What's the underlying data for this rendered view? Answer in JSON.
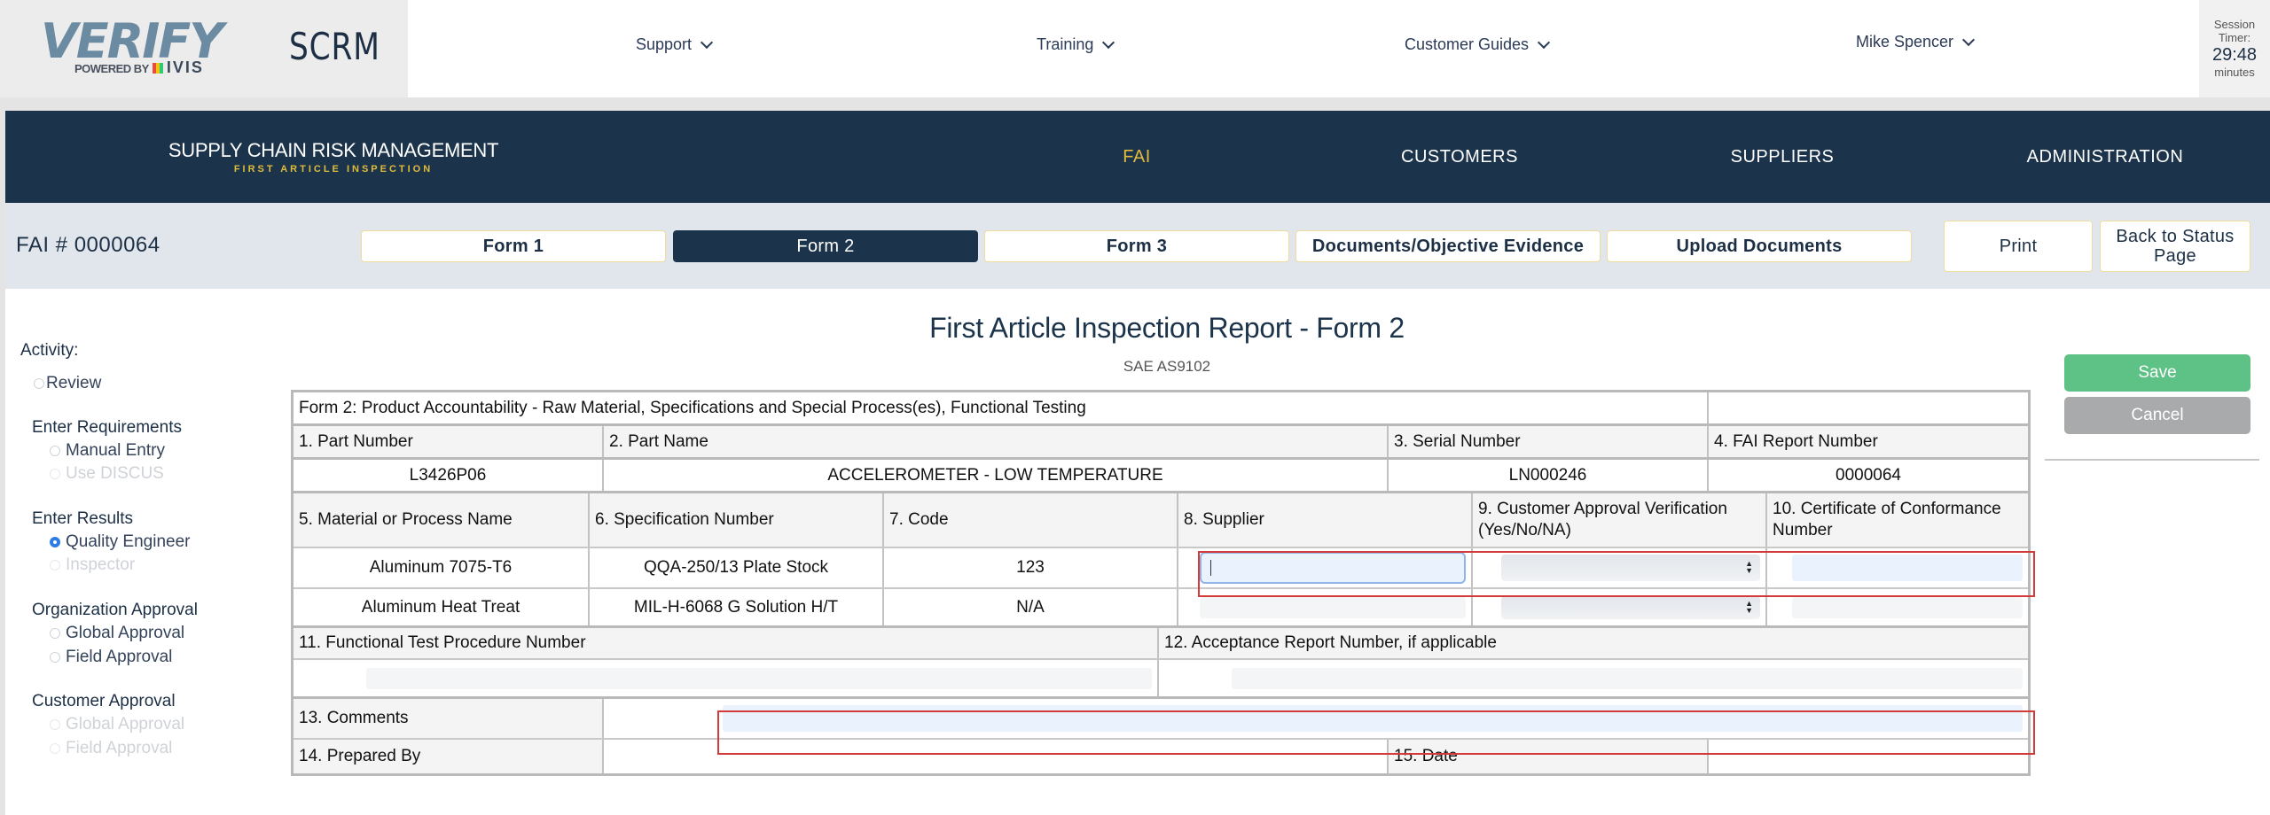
{
  "brand": {
    "logo_word": "VERIFY",
    "logo_powered": "POWERED BY",
    "logo_ivis": "IVIS",
    "app_name": "SCRM"
  },
  "topnav": {
    "items": [
      {
        "label": "Support",
        "icon": "chevron-down-icon"
      },
      {
        "label": "Training",
        "icon": "chevron-down-icon"
      },
      {
        "label": "Customer Guides",
        "icon": "chevron-down-icon"
      }
    ],
    "user": {
      "label": "Mike Spencer",
      "icon": "chevron-down-icon"
    },
    "session": {
      "label1": "Session",
      "label2": "Timer:",
      "time": "29:48",
      "unit": "minutes"
    }
  },
  "mainnav": {
    "title": "SUPPLY CHAIN RISK MANAGEMENT",
    "subtitle": "FIRST ARTICLE INSPECTION",
    "items": [
      {
        "label": "FAI",
        "active": true
      },
      {
        "label": "CUSTOMERS"
      },
      {
        "label": "SUPPLIERS"
      },
      {
        "label": "ADMINISTRATION"
      }
    ],
    "accent_color": "#e0bb3c"
  },
  "subbar": {
    "fai_number": "FAI # 0000064",
    "tabs": [
      {
        "label": "Form 1"
      },
      {
        "label": "Form 2",
        "active": true
      },
      {
        "label": "Form 3"
      },
      {
        "label": "Documents/Objective Evidence"
      },
      {
        "label": "Upload Documents"
      }
    ],
    "print_label": "Print",
    "back_label": "Back to Status Page"
  },
  "sidebar": {
    "activity_label": "Activity:",
    "review": {
      "label": "Review",
      "checked": false
    },
    "groups": [
      {
        "heading": "Enter Requirements",
        "options": [
          {
            "label": "Manual Entry",
            "disabled": false
          },
          {
            "label": "Use DISCUS",
            "disabled": true
          }
        ]
      },
      {
        "heading": "Enter Results",
        "options": [
          {
            "label": "Quality Engineer",
            "checked": true
          },
          {
            "label": "Inspector",
            "disabled": true
          }
        ]
      },
      {
        "heading": "Organization Approval",
        "options": [
          {
            "label": "Global Approval"
          },
          {
            "label": "Field Approval"
          }
        ]
      },
      {
        "heading": "Customer Approval",
        "options": [
          {
            "label": "Global Approval",
            "disabled": true
          },
          {
            "label": "Field Approval",
            "disabled": true
          }
        ]
      }
    ]
  },
  "form": {
    "title": "First Article Inspection Report - Form 2",
    "subtitle": "SAE AS9102",
    "section_title": "Form 2: Product Accountability - Raw Material, Specifications and Special Process(es), Functional Testing",
    "header_labels": {
      "part_number": "1. Part Number",
      "part_name": "2. Part Name",
      "serial_number": "3. Serial Number",
      "fai_report_number": "4. FAI Report Number"
    },
    "header_values": {
      "part_number": "L3426P06",
      "part_name": "ACCELEROMETER - LOW TEMPERATURE",
      "serial_number": "LN000246",
      "fai_report_number": "0000064"
    },
    "material_columns": [
      "5. Material or Process Name",
      "6. Specification Number",
      "7. Code",
      "8. Supplier",
      "9. Customer Approval Verification (Yes/No/NA)",
      "10. Certificate of Conformance Number"
    ],
    "material_rows": [
      {
        "name": "Aluminum 7075-T6",
        "spec": "QQA-250/13 Plate Stock",
        "code": "123",
        "supplier": "",
        "approval": "",
        "coc": ""
      },
      {
        "name": "Aluminum Heat Treat",
        "spec": "MIL-H-6068 G Solution H/T",
        "code": "N/A",
        "supplier": "",
        "approval": "",
        "coc": ""
      }
    ],
    "functional_test_label": "11. Functional Test Procedure Number",
    "functional_test_value": "",
    "acceptance_report_label": "12. Acceptance Report Number, if applicable",
    "acceptance_report_value": "",
    "comments_label": "13. Comments",
    "comments_value": "",
    "prepared_by_label": "14. Prepared By",
    "prepared_by_value": "",
    "date_label": "15. Date",
    "date_value": ""
  },
  "actions": {
    "save_label": "Save",
    "cancel_label": "Cancel",
    "save_color": "#5ec185",
    "cancel_color": "#a9aaac"
  },
  "highlight_color": "#d33a3a"
}
